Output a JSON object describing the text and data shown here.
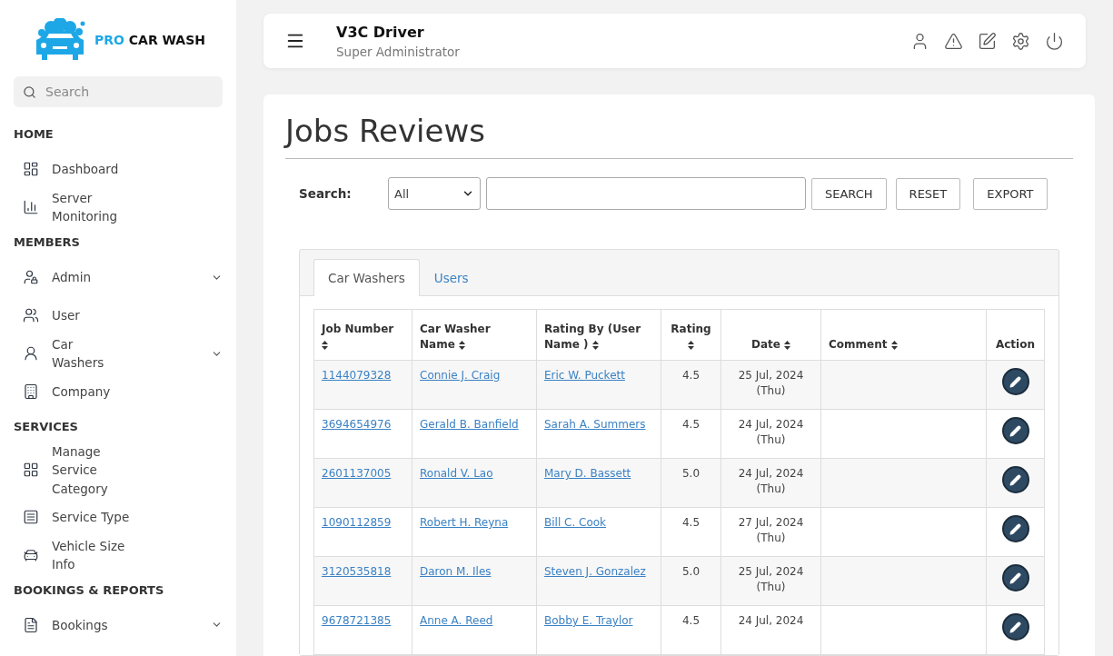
{
  "brand": {
    "accent": "PRO",
    "name": "CAR WASH"
  },
  "sidebar": {
    "search": {
      "placeholder": "Search"
    },
    "sections": [
      {
        "title": "HOME",
        "items": [
          {
            "label": "Dashboard",
            "submenu": false
          },
          {
            "label": "Server Monitoring",
            "submenu": false
          }
        ]
      },
      {
        "title": "MEMBERS",
        "items": [
          {
            "label": "Admin",
            "submenu": true
          },
          {
            "label": "User",
            "submenu": false
          },
          {
            "label": "Car Washers",
            "submenu": true
          },
          {
            "label": "Company",
            "submenu": false
          }
        ]
      },
      {
        "title": "SERVICES",
        "items": [
          {
            "label": "Manage Service Category",
            "submenu": false
          },
          {
            "label": "Service Type",
            "submenu": false
          },
          {
            "label": "Vehicle Size Info",
            "submenu": false
          }
        ]
      },
      {
        "title": "BOOKINGS & REPORTS",
        "items": [
          {
            "label": "Bookings",
            "submenu": true
          }
        ]
      }
    ]
  },
  "header": {
    "user": "V3C Driver",
    "role": "Super Administrator"
  },
  "page": {
    "title": "Jobs Reviews",
    "search": {
      "label": "Search:",
      "filter": "All",
      "buttons": [
        "SEARCH",
        "RESET",
        "EXPORT"
      ]
    },
    "tabs": [
      {
        "label": "Car Washers",
        "selected": true
      },
      {
        "label": "Users",
        "selected": false
      }
    ],
    "table": {
      "columns": [
        {
          "label": "Job Number",
          "sortable": true
        },
        {
          "label": "Car Washer Name",
          "sortable": true
        },
        {
          "label": "Rating By (User Name )",
          "sortable": true
        },
        {
          "label": "Rating",
          "sortable": true
        },
        {
          "label": "Date",
          "sortable": true
        },
        {
          "label": "Comment",
          "sortable": true
        },
        {
          "label": "Action",
          "sortable": false
        }
      ],
      "rows": [
        {
          "job": "1144079328",
          "washer": "Connie J. Craig",
          "rater": "Eric W. Puckett",
          "rating": "4.5",
          "date": "25 Jul, 2024",
          "day": "(Thu)"
        },
        {
          "job": "3694654976",
          "washer": "Gerald B. Banfield",
          "rater": "Sarah A. Summers",
          "rating": "4.5",
          "date": "24 Jul, 2024",
          "day": "(Thu)"
        },
        {
          "job": "2601137005",
          "washer": "Ronald V. Lao",
          "rater": "Mary D. Bassett",
          "rating": "5.0",
          "date": "24 Jul, 2024",
          "day": "(Thu)"
        },
        {
          "job": "1090112859",
          "washer": "Robert H. Reyna",
          "rater": "Bill C. Cook",
          "rating": "4.5",
          "date": "27 Jul, 2024",
          "day": "(Thu)"
        },
        {
          "job": "3120535818",
          "washer": "Daron M. Iles",
          "rater": "Steven J. Gonzalez",
          "rating": "5.0",
          "date": "25 Jul, 2024",
          "day": "(Thu)"
        },
        {
          "job": "9678721385",
          "washer": "Anne A. Reed",
          "rater": "Bobby E. Traylor",
          "rating": "4.5",
          "date": "24 Jul, 2024"
        }
      ]
    }
  }
}
